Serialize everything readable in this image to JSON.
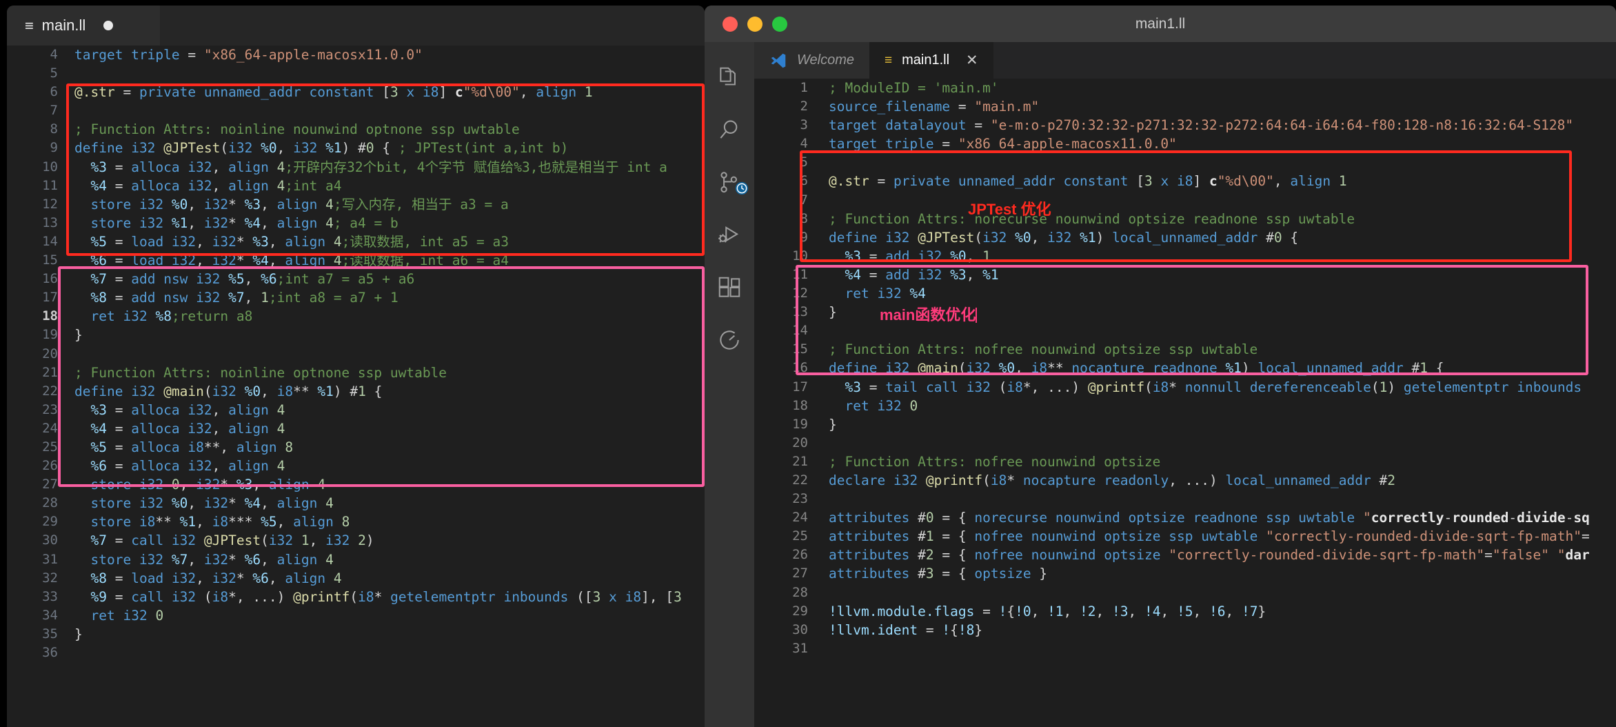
{
  "left_window": {
    "tab": {
      "icon": "list-icon",
      "title": "main.ll",
      "modified_dot": "●"
    },
    "code_lines": [
      {
        "n": "4",
        "text": "target triple = \"x86_64-apple-macosx11.0.0\""
      },
      {
        "n": "5",
        "text": ""
      },
      {
        "n": "6",
        "text": "@.str = private unnamed_addr constant [3 x i8] c\"%d\\00\", align 1"
      },
      {
        "n": "7",
        "text": ""
      },
      {
        "n": "8",
        "text": "; Function Attrs: noinline nounwind optnone ssp uwtable"
      },
      {
        "n": "9",
        "text": "define i32 @JPTest(i32 %0, i32 %1) #0 { ; JPTest(int a,int b)"
      },
      {
        "n": "10",
        "text": "  %3 = alloca i32, align 4;开辟内存32个bit, 4个字节 赋值给%3,也就是相当于 int a"
      },
      {
        "n": "11",
        "text": "  %4 = alloca i32, align 4;int a4"
      },
      {
        "n": "12",
        "text": "  store i32 %0, i32* %3, align 4;写入内存, 相当于 a3 = a"
      },
      {
        "n": "13",
        "text": "  store i32 %1, i32* %4, align 4; a4 = b"
      },
      {
        "n": "14",
        "text": "  %5 = load i32, i32* %3, align 4;读取数据, int a5 = a3"
      },
      {
        "n": "15",
        "text": "  %6 = load i32, i32* %4, align 4;读取数据, int a6 = a4"
      },
      {
        "n": "16",
        "text": "  %7 = add nsw i32 %5, %6;int a7 = a5 + a6"
      },
      {
        "n": "17",
        "text": "  %8 = add nsw i32 %7, 1;int a8 = a7 + 1"
      },
      {
        "n": "18",
        "text": "  ret i32 %8;return a8"
      },
      {
        "n": "19",
        "text": "}"
      },
      {
        "n": "20",
        "text": ""
      },
      {
        "n": "21",
        "text": "; Function Attrs: noinline optnone ssp uwtable"
      },
      {
        "n": "22",
        "text": "define i32 @main(i32 %0, i8** %1) #1 {"
      },
      {
        "n": "23",
        "text": "  %3 = alloca i32, align 4"
      },
      {
        "n": "24",
        "text": "  %4 = alloca i32, align 4"
      },
      {
        "n": "25",
        "text": "  %5 = alloca i8**, align 8"
      },
      {
        "n": "26",
        "text": "  %6 = alloca i32, align 4"
      },
      {
        "n": "27",
        "text": "  store i32 0, i32* %3, align 4"
      },
      {
        "n": "28",
        "text": "  store i32 %0, i32* %4, align 4"
      },
      {
        "n": "29",
        "text": "  store i8** %1, i8*** %5, align 8"
      },
      {
        "n": "30",
        "text": "  %7 = call i32 @JPTest(i32 1, i32 2)"
      },
      {
        "n": "31",
        "text": "  store i32 %7, i32* %6, align 4"
      },
      {
        "n": "32",
        "text": "  %8 = load i32, i32* %6, align 4"
      },
      {
        "n": "33",
        "text": "  %9 = call i32 (i8*, ...) @printf(i8* getelementptr inbounds ([3 x i8], [3"
      },
      {
        "n": "34",
        "text": "  ret i32 0"
      },
      {
        "n": "35",
        "text": "}"
      },
      {
        "n": "36",
        "text": ""
      }
    ],
    "current_line": "18",
    "highlight_red": {
      "label": "jptest-unoptimized-highlight",
      "color": "#ff2a1f"
    },
    "highlight_pink": {
      "label": "main-unoptimized-highlight",
      "color": "#f95fa0"
    }
  },
  "right_window": {
    "title": "main1.ll",
    "traffic_lights": {
      "close": "close-button",
      "minimize": "minimize-button",
      "maximize": "maximize-button"
    },
    "activity_bar": [
      {
        "name": "explorer-icon",
        "label": "Explorer"
      },
      {
        "name": "search-icon",
        "label": "Search"
      },
      {
        "name": "source-control-icon",
        "label": "Source Control"
      },
      {
        "name": "run-debug-icon",
        "label": "Run and Debug"
      },
      {
        "name": "extensions-icon",
        "label": "Extensions"
      },
      {
        "name": "timeline-icon",
        "label": "Timeline"
      }
    ],
    "tabs": [
      {
        "label": "Welcome",
        "icon": "vscode-logo-icon",
        "active": false,
        "closable": false
      },
      {
        "label": "main1.ll",
        "icon": "list-icon",
        "active": true,
        "closable": true,
        "close_glyph": "✕"
      }
    ],
    "code_lines": [
      {
        "n": "1",
        "text": "; ModuleID = 'main.m'"
      },
      {
        "n": "2",
        "text": "source_filename = \"main.m\""
      },
      {
        "n": "3",
        "text": "target datalayout = \"e-m:o-p270:32:32-p271:32:32-p272:64:64-i64:64-f80:128-n8:16:32:64-S128\""
      },
      {
        "n": "4",
        "text": "target triple = \"x86_64-apple-macosx11.0.0\""
      },
      {
        "n": "5",
        "text": ""
      },
      {
        "n": "6",
        "text": "@.str = private unnamed_addr constant [3 x i8] c\"%d\\00\", align 1"
      },
      {
        "n": "7",
        "text": ""
      },
      {
        "n": "8",
        "text": "; Function Attrs: norecurse nounwind optsize readnone ssp uwtable"
      },
      {
        "n": "9",
        "text": "define i32 @JPTest(i32 %0, i32 %1) local_unnamed_addr #0 {"
      },
      {
        "n": "10",
        "text": "  %3 = add i32 %0, 1"
      },
      {
        "n": "11",
        "text": "  %4 = add i32 %3, %1"
      },
      {
        "n": "12",
        "text": "  ret i32 %4"
      },
      {
        "n": "13",
        "text": "}"
      },
      {
        "n": "14",
        "text": ""
      },
      {
        "n": "15",
        "text": "; Function Attrs: nofree nounwind optsize ssp uwtable"
      },
      {
        "n": "16",
        "text": "define i32 @main(i32 %0, i8** nocapture readnone %1) local_unnamed_addr #1 {"
      },
      {
        "n": "17",
        "text": "  %3 = tail call i32 (i8*, ...) @printf(i8* nonnull dereferenceable(1) getelementptr inbounds"
      },
      {
        "n": "18",
        "text": "  ret i32 0"
      },
      {
        "n": "19",
        "text": "}"
      },
      {
        "n": "20",
        "text": ""
      },
      {
        "n": "21",
        "text": "; Function Attrs: nofree nounwind optsize"
      },
      {
        "n": "22",
        "text": "declare i32 @printf(i8* nocapture readonly, ...) local_unnamed_addr #2"
      },
      {
        "n": "23",
        "text": ""
      },
      {
        "n": "24",
        "text": "attributes #0 = { norecurse nounwind optsize readnone ssp uwtable \"correctly-rounded-divide-sq"
      },
      {
        "n": "25",
        "text": "attributes #1 = { nofree nounwind optsize ssp uwtable \"correctly-rounded-divide-sqrt-fp-math\"="
      },
      {
        "n": "26",
        "text": "attributes #2 = { nofree nounwind optsize \"correctly-rounded-divide-sqrt-fp-math\"=\"false\" \"dar"
      },
      {
        "n": "27",
        "text": "attributes #3 = { optsize }"
      },
      {
        "n": "28",
        "text": ""
      },
      {
        "n": "29",
        "text": "!llvm.module.flags = !{!0, !1, !2, !3, !4, !5, !6, !7}"
      },
      {
        "n": "30",
        "text": "!llvm.ident = !{!8}"
      },
      {
        "n": "31",
        "text": ""
      }
    ],
    "annotations": [
      {
        "name": "jptest-optimized-note",
        "text": "JPTest 优化",
        "color": "#ff2a1f"
      },
      {
        "name": "main-optimized-note",
        "text": "main函数优化",
        "color": "#ff3b7b"
      }
    ],
    "highlight_red": {
      "label": "jptest-optimized-highlight",
      "color": "#ff2a1f"
    },
    "highlight_pink": {
      "label": "main-optimized-highlight",
      "color": "#f95fa0"
    }
  }
}
